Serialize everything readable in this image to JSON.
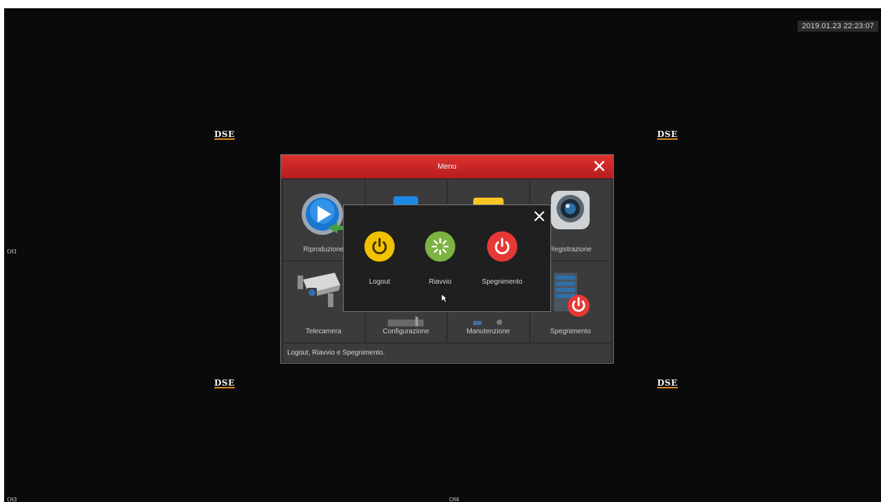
{
  "app": {
    "datetime": "2019.01.23   22:23:07",
    "logo_text": "DSE",
    "channels": [
      "CH1",
      "CH3",
      "CH4"
    ]
  },
  "menu": {
    "title": "Menu",
    "tiles": [
      {
        "label": "Riproduzione",
        "icon": "playback-icon"
      },
      {
        "label": "",
        "icon": "search-icon"
      },
      {
        "label": "",
        "icon": "folder-icon"
      },
      {
        "label": "Registrazione",
        "icon": "record-camera-icon"
      },
      {
        "label": "Telecamera",
        "icon": "cctv-camera-icon"
      },
      {
        "label": "Configurazione",
        "icon": "settings-icon"
      },
      {
        "label": "Manutenzione",
        "icon": "maintenance-icon"
      },
      {
        "label": "Spegnimento",
        "icon": "server-power-icon"
      }
    ],
    "status_text": "Logout, Riavvio e Spegnimento."
  },
  "power_popup": {
    "logout_label": "Logout",
    "reboot_label": "Riavvio",
    "shutdown_label": "Spegnimento"
  },
  "colors": {
    "header_red": "#c62828",
    "logout_yellow": "#f2c200",
    "reboot_green": "#7cb342",
    "shutdown_red": "#e53935",
    "logo_accent": "#e08a1e"
  }
}
